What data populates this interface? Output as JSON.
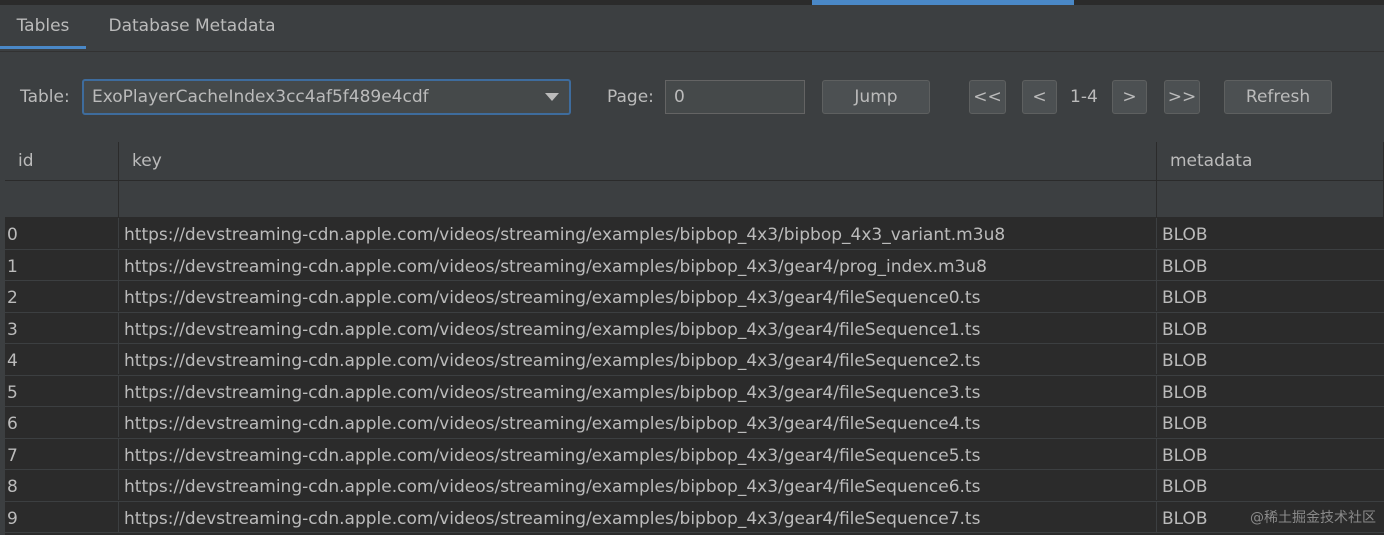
{
  "tabs": [
    {
      "label": "Tables",
      "active": true
    },
    {
      "label": "Database Metadata",
      "active": false
    }
  ],
  "toolbar": {
    "table_label": "Table:",
    "table_value": "ExoPlayerCacheIndex3cc4af5f489e4cdf",
    "page_label": "Page:",
    "page_value": "0",
    "jump_label": "Jump",
    "first_label": "<<",
    "prev_label": "<",
    "range_text": "1-4",
    "next_label": ">",
    "last_label": ">>",
    "refresh_label": "Refresh"
  },
  "table": {
    "columns": [
      "id",
      "key",
      "metadata"
    ],
    "rows": [
      [
        "0",
        "https://devstreaming-cdn.apple.com/videos/streaming/examples/bipbop_4x3/bipbop_4x3_variant.m3u8",
        "BLOB"
      ],
      [
        "1",
        "https://devstreaming-cdn.apple.com/videos/streaming/examples/bipbop_4x3/gear4/prog_index.m3u8",
        "BLOB"
      ],
      [
        "2",
        "https://devstreaming-cdn.apple.com/videos/streaming/examples/bipbop_4x3/gear4/fileSequence0.ts",
        "BLOB"
      ],
      [
        "3",
        "https://devstreaming-cdn.apple.com/videos/streaming/examples/bipbop_4x3/gear4/fileSequence1.ts",
        "BLOB"
      ],
      [
        "4",
        "https://devstreaming-cdn.apple.com/videos/streaming/examples/bipbop_4x3/gear4/fileSequence2.ts",
        "BLOB"
      ],
      [
        "5",
        "https://devstreaming-cdn.apple.com/videos/streaming/examples/bipbop_4x3/gear4/fileSequence3.ts",
        "BLOB"
      ],
      [
        "6",
        "https://devstreaming-cdn.apple.com/videos/streaming/examples/bipbop_4x3/gear4/fileSequence4.ts",
        "BLOB"
      ],
      [
        "7",
        "https://devstreaming-cdn.apple.com/videos/streaming/examples/bipbop_4x3/gear4/fileSequence5.ts",
        "BLOB"
      ],
      [
        "8",
        "https://devstreaming-cdn.apple.com/videos/streaming/examples/bipbop_4x3/gear4/fileSequence6.ts",
        "BLOB"
      ],
      [
        "9",
        "https://devstreaming-cdn.apple.com/videos/streaming/examples/bipbop_4x3/gear4/fileSequence7.ts",
        "BLOB"
      ]
    ]
  },
  "watermark": "@稀土掘金技术社区",
  "colors": {
    "accent": "#4a88c7",
    "background": "#3c3f41",
    "grid_background": "#2b2b2b",
    "text": "#bbbbbb"
  }
}
